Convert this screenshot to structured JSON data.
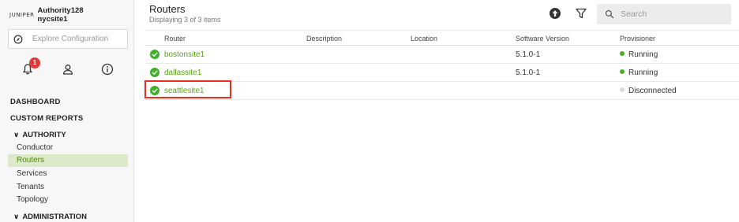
{
  "brand": {
    "logo_text": "JUNIPER",
    "authority": "Authority128",
    "site": "nycsite1"
  },
  "explore": {
    "placeholder": "Explore Configuration",
    "icon": "compass-icon"
  },
  "notifications": {
    "count": "1"
  },
  "nav": {
    "dashboard": "DASHBOARD",
    "custom_reports": "CUSTOM REPORTS",
    "authority_section": "AUTHORITY",
    "items": [
      {
        "label": "Conductor"
      },
      {
        "label": "Routers"
      },
      {
        "label": "Services"
      },
      {
        "label": "Tenants"
      },
      {
        "label": "Topology"
      }
    ],
    "administration_section": "ADMINISTRATION",
    "active_item": "Routers"
  },
  "header": {
    "title": "Routers",
    "subtitle": "Displaying 3 of 3 items",
    "search_placeholder": "Search"
  },
  "table": {
    "columns": [
      "Router",
      "Description",
      "Location",
      "Software Version",
      "Provisioner"
    ],
    "rows": [
      {
        "router": "bostonsite1",
        "description": "",
        "location": "",
        "version": "5.1.0-1",
        "status": "Running",
        "status_color": "#4caf28"
      },
      {
        "router": "dallassite1",
        "description": "",
        "location": "",
        "version": "5.1.0-1",
        "status": "Running",
        "status_color": "#4caf28"
      },
      {
        "router": "seattlesite1",
        "description": "",
        "location": "",
        "version": "",
        "status": "Disconnected",
        "status_color": "#d9d9d9"
      }
    ]
  },
  "colors": {
    "accent_green": "#5aa21a",
    "active_bg": "#dde9c9",
    "highlight_red": "#e8301c",
    "badge_red": "#e23a3a"
  }
}
